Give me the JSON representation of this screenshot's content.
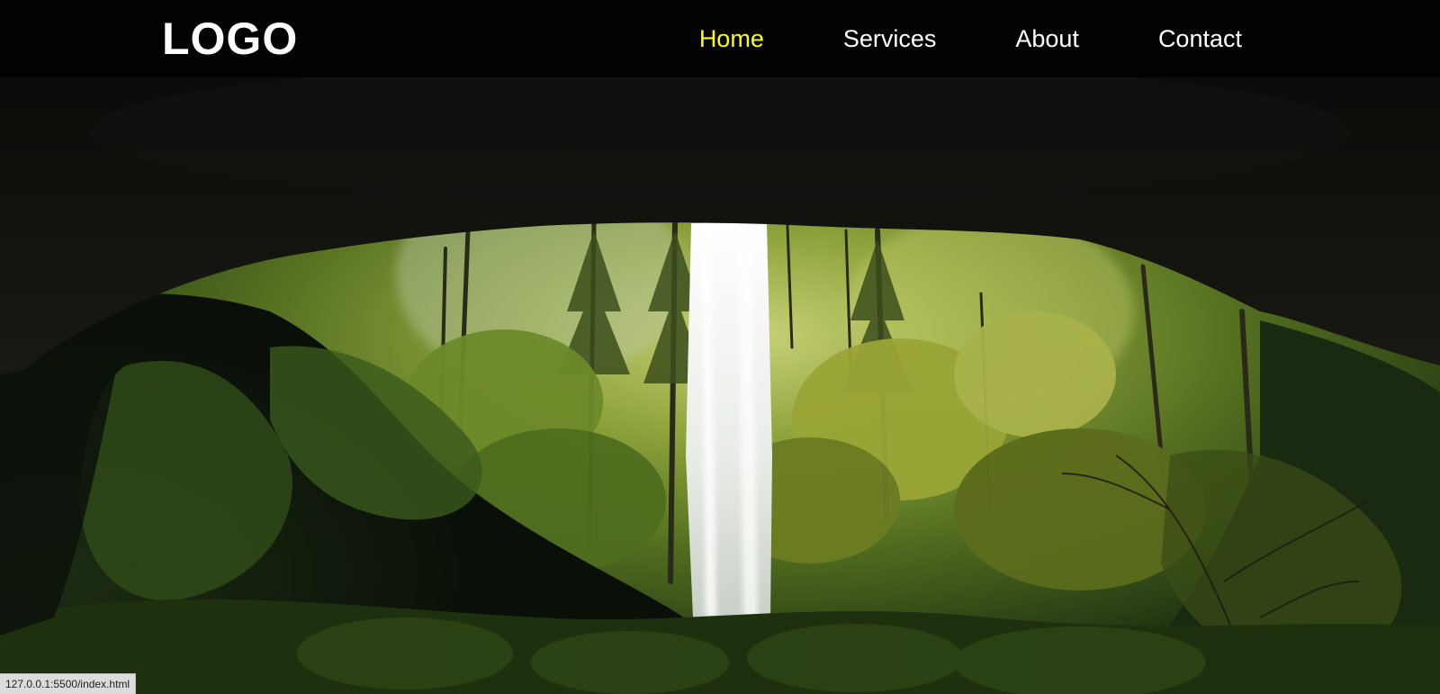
{
  "header": {
    "logo_text": "LOGO",
    "nav": [
      {
        "label": "Home",
        "active": true
      },
      {
        "label": "Services",
        "active": false
      },
      {
        "label": "About",
        "active": false
      },
      {
        "label": "Contact",
        "active": false
      }
    ]
  },
  "colors": {
    "header_bg": "#030303",
    "nav_text": "#ffffff",
    "nav_active": "#ffff00"
  },
  "hero": {
    "image": "waterfall-viewed-from-cave-in-forest"
  },
  "status_bar": {
    "url": "127.0.0.1:5500/index.html"
  }
}
